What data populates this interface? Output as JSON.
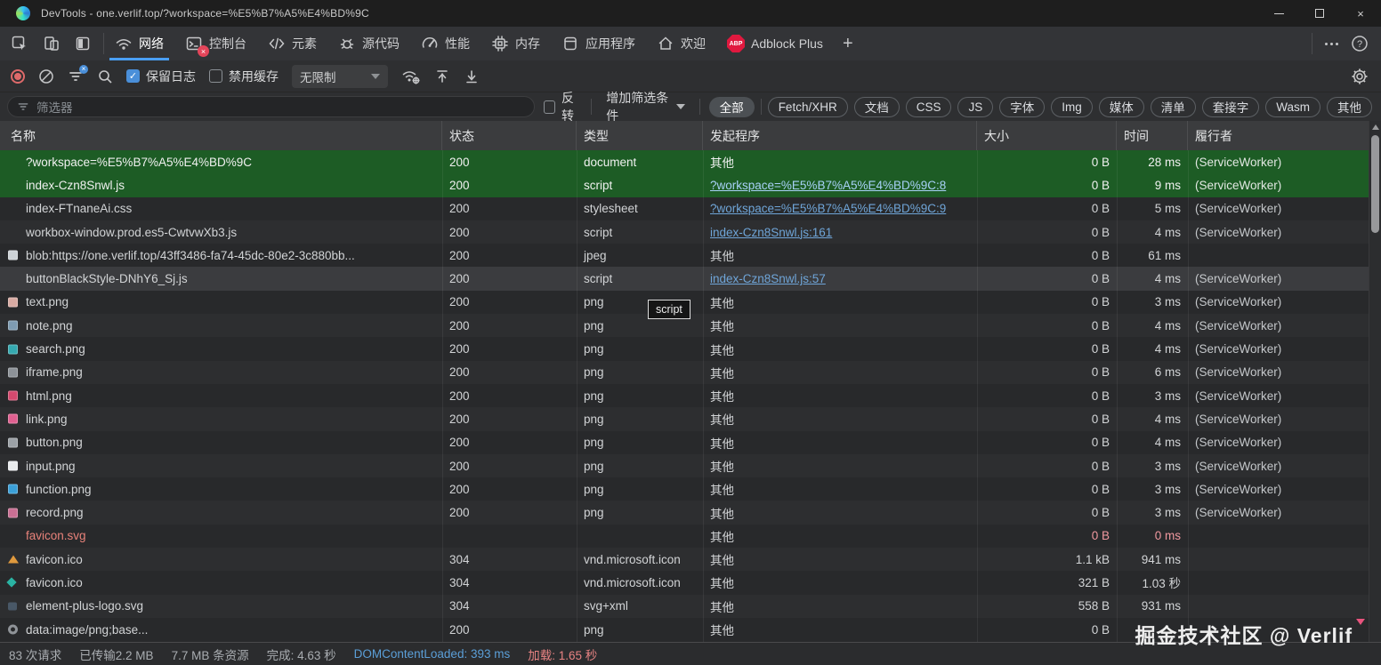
{
  "window": {
    "title": "DevTools - one.verlif.top/?workspace=%E5%B7%A5%E4%BD%9C",
    "controls": [
      "minimize-icon",
      "maximize-icon",
      "close-icon"
    ]
  },
  "tabbar": {
    "util_icons": [
      "inspect-icon",
      "device-toolbar-icon",
      "dock-side-icon"
    ],
    "tabs": [
      {
        "id": "network",
        "icon": "network-icon",
        "label": "网络",
        "active": true
      },
      {
        "id": "console",
        "icon": "console-icon",
        "label": "控制台",
        "badge": "×"
      },
      {
        "id": "elements",
        "icon": "elements-icon",
        "label": "元素"
      },
      {
        "id": "sources",
        "icon": "sources-icon",
        "label": "源代码"
      },
      {
        "id": "performance",
        "icon": "performance-icon",
        "label": "性能"
      },
      {
        "id": "memory",
        "icon": "memory-icon",
        "label": "内存"
      },
      {
        "id": "application",
        "icon": "application-icon",
        "label": "应用程序"
      },
      {
        "id": "welcome",
        "icon": "home-icon",
        "label": "欢迎"
      },
      {
        "id": "adblock",
        "icon": "abp-icon",
        "label": "Adblock Plus"
      }
    ],
    "more_tabs_label": "+",
    "right_icons": [
      "kebab-menu-icon",
      "help-icon"
    ]
  },
  "toolbar": {
    "icons": [
      "record-icon",
      "clear-icon",
      "filter-toggle-icon",
      "search-icon",
      "network-conditions-icon",
      "import-har-icon",
      "export-har-icon",
      "settings-gear-icon"
    ],
    "preserve_log_label": "保留日志",
    "preserve_log_checked": true,
    "disable_cache_label": "禁用缓存",
    "disable_cache_checked": false,
    "throttling_value": "无限制"
  },
  "filterbar": {
    "placeholder": "筛选器",
    "invert_label": "反转",
    "invert_checked": false,
    "more_filters_label": "增加筛选条件",
    "chips": [
      {
        "label": "全部",
        "active": true
      },
      {
        "label": "Fetch/XHR"
      },
      {
        "label": "文档"
      },
      {
        "label": "CSS"
      },
      {
        "label": "JS"
      },
      {
        "label": "字体"
      },
      {
        "label": "Img"
      },
      {
        "label": "媒体"
      },
      {
        "label": "清单"
      },
      {
        "label": "套接字"
      },
      {
        "label": "Wasm"
      },
      {
        "label": "其他"
      }
    ]
  },
  "table": {
    "headers": [
      "名称",
      "状态",
      "类型",
      "发起程序",
      "大小",
      "时间",
      "履行者"
    ],
    "rows": [
      {
        "name": "?workspace=%E5%B7%A5%E4%BD%9C",
        "status": "200",
        "type": "document",
        "initiator": "其他",
        "initiator_link": false,
        "size": "0 B",
        "time": "28 ms",
        "fulfilled": "(ServiceWorker)",
        "state": "selected",
        "icon": null
      },
      {
        "name": "index-Czn8Snwl.js",
        "status": "200",
        "type": "script",
        "initiator": "?workspace=%E5%B7%A5%E4%BD%9C:8",
        "initiator_link": true,
        "size": "0 B",
        "time": "9 ms",
        "fulfilled": "(ServiceWorker)",
        "state": "selected",
        "icon": null
      },
      {
        "name": "index-FTnaneAi.css",
        "status": "200",
        "type": "stylesheet",
        "initiator": "?workspace=%E5%B7%A5%E4%BD%9C:9",
        "initiator_link": true,
        "size": "0 B",
        "time": "5 ms",
        "fulfilled": "(ServiceWorker)",
        "state": "",
        "icon": null
      },
      {
        "name": "workbox-window.prod.es5-CwtvwXb3.js",
        "status": "200",
        "type": "script",
        "initiator": "index-Czn8Snwl.js:161",
        "initiator_link": true,
        "size": "0 B",
        "time": "4 ms",
        "fulfilled": "(ServiceWorker)",
        "state": "",
        "icon": null
      },
      {
        "name": "blob:https://one.verlif.top/43ff3486-fa74-45dc-80e2-3c880bb...",
        "status": "200",
        "type": "jpeg",
        "initiator": "其他",
        "initiator_link": false,
        "size": "0 B",
        "time": "61 ms",
        "fulfilled": "",
        "state": "",
        "icon": {
          "kind": "thumb",
          "color": "#cdd2d6"
        }
      },
      {
        "name": "buttonBlackStyle-DNhY6_Sj.js",
        "status": "200",
        "type": "script",
        "initiator": "index-Czn8Snwl.js:57",
        "initiator_link": true,
        "size": "0 B",
        "time": "4 ms",
        "fulfilled": "(ServiceWorker)",
        "state": "hover",
        "icon": null
      },
      {
        "name": "text.png",
        "status": "200",
        "type": "png",
        "initiator": "其他",
        "initiator_link": false,
        "size": "0 B",
        "time": "3 ms",
        "fulfilled": "(ServiceWorker)",
        "state": "",
        "icon": {
          "kind": "thumb",
          "color": "#d8aba3"
        }
      },
      {
        "name": "note.png",
        "status": "200",
        "type": "png",
        "initiator": "其他",
        "initiator_link": false,
        "size": "0 B",
        "time": "4 ms",
        "fulfilled": "(ServiceWorker)",
        "state": "",
        "icon": {
          "kind": "thumb",
          "color": "#7e9bb1"
        }
      },
      {
        "name": "search.png",
        "status": "200",
        "type": "png",
        "initiator": "其他",
        "initiator_link": false,
        "size": "0 B",
        "time": "4 ms",
        "fulfilled": "(ServiceWorker)",
        "state": "",
        "icon": {
          "kind": "thumb",
          "color": "#35a9b0"
        }
      },
      {
        "name": "iframe.png",
        "status": "200",
        "type": "png",
        "initiator": "其他",
        "initiator_link": false,
        "size": "0 B",
        "time": "6 ms",
        "fulfilled": "(ServiceWorker)",
        "state": "",
        "icon": {
          "kind": "thumb",
          "color": "#8d9298"
        }
      },
      {
        "name": "html.png",
        "status": "200",
        "type": "png",
        "initiator": "其他",
        "initiator_link": false,
        "size": "0 B",
        "time": "3 ms",
        "fulfilled": "(ServiceWorker)",
        "state": "",
        "icon": {
          "kind": "thumb",
          "color": "#d4496e"
        }
      },
      {
        "name": "link.png",
        "status": "200",
        "type": "png",
        "initiator": "其他",
        "initiator_link": false,
        "size": "0 B",
        "time": "4 ms",
        "fulfilled": "(ServiceWorker)",
        "state": "",
        "icon": {
          "kind": "thumb",
          "color": "#e06090"
        }
      },
      {
        "name": "button.png",
        "status": "200",
        "type": "png",
        "initiator": "其他",
        "initiator_link": false,
        "size": "0 B",
        "time": "4 ms",
        "fulfilled": "(ServiceWorker)",
        "state": "",
        "icon": {
          "kind": "thumb",
          "color": "#9ba1a6"
        }
      },
      {
        "name": "input.png",
        "status": "200",
        "type": "png",
        "initiator": "其他",
        "initiator_link": false,
        "size": "0 B",
        "time": "3 ms",
        "fulfilled": "(ServiceWorker)",
        "state": "",
        "icon": {
          "kind": "thumb",
          "color": "#e9ebed"
        }
      },
      {
        "name": "function.png",
        "status": "200",
        "type": "png",
        "initiator": "其他",
        "initiator_link": false,
        "size": "0 B",
        "time": "3 ms",
        "fulfilled": "(ServiceWorker)",
        "state": "",
        "icon": {
          "kind": "thumb",
          "color": "#3ba0d8"
        }
      },
      {
        "name": "record.png",
        "status": "200",
        "type": "png",
        "initiator": "其他",
        "initiator_link": false,
        "size": "0 B",
        "time": "3 ms",
        "fulfilled": "(ServiceWorker)",
        "state": "",
        "icon": {
          "kind": "thumb",
          "color": "#c96f93"
        }
      },
      {
        "name": "favicon.svg",
        "status": "",
        "type": "",
        "initiator": "其他",
        "initiator_link": false,
        "size": "0 B",
        "time": "0 ms",
        "fulfilled": "",
        "state": "error",
        "icon": null
      },
      {
        "name": "favicon.ico",
        "status": "304",
        "type": "vnd.microsoft.icon",
        "initiator": "其他",
        "initiator_link": false,
        "size": "1.1 kB",
        "time": "941 ms",
        "fulfilled": "",
        "state": "",
        "icon": {
          "kind": "triangle"
        }
      },
      {
        "name": "favicon.ico",
        "status": "304",
        "type": "vnd.microsoft.icon",
        "initiator": "其他",
        "initiator_link": false,
        "size": "321 B",
        "time": "1.03 秒",
        "fulfilled": "",
        "state": "",
        "icon": {
          "kind": "diamond"
        }
      },
      {
        "name": "element-plus-logo.svg",
        "status": "304",
        "type": "svg+xml",
        "initiator": "其他",
        "initiator_link": false,
        "size": "558 B",
        "time": "931 ms",
        "fulfilled": "",
        "state": "",
        "icon": {
          "kind": "dots"
        }
      },
      {
        "name": "data:image/png;base...",
        "status": "200",
        "type": "png",
        "initiator": "其他",
        "initiator_link": false,
        "size": "0 B",
        "time": "",
        "fulfilled": "",
        "state": "",
        "icon": {
          "kind": "donut"
        }
      }
    ]
  },
  "tooltip": {
    "text": "script"
  },
  "statusbar": {
    "requests": "83 次请求",
    "transferred": "已传输2.2 MB",
    "resources": "7.7 MB 条资源",
    "finish": "完成: 4.63 秒",
    "dom_content_loaded": "DOMContentLoaded: 393 ms",
    "load": "加载: 1.65 秒"
  },
  "watermark": {
    "text": "掘金技术社区 @ Verlif"
  },
  "colors": {
    "accent_blue": "#4a9ff5",
    "selected_row_green": "#1d5c25",
    "link_blue": "#6fa5d8",
    "error_red": "#e8827a",
    "record_red": "#de6a6a",
    "abp_red": "#e0193f",
    "dcl_blue": "#5b9fd8",
    "load_red": "#e88383"
  }
}
